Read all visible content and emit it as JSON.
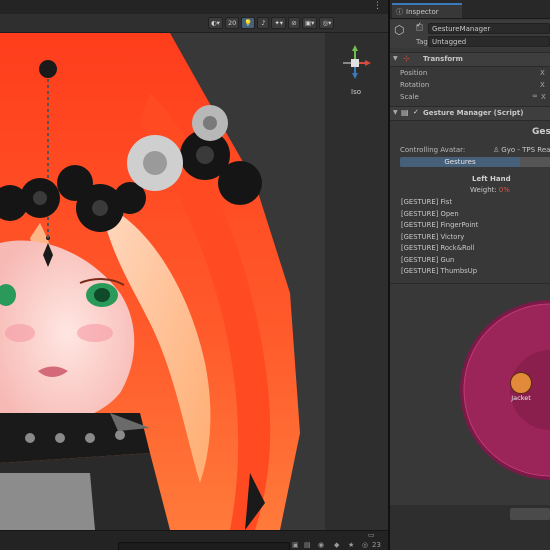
{
  "scene": {
    "toolbar": {
      "grid_size": "20",
      "iso_label": "Iso",
      "gizmo_count": "23"
    }
  },
  "inspector": {
    "tab_label": "Inspector",
    "object_name": "GestureManager",
    "tag_label": "Tag",
    "tag_value": "Untagged",
    "transform": {
      "title": "Transform",
      "position_label": "Position",
      "rotation_label": "Rotation",
      "scale_label": "Scale"
    },
    "component": {
      "title": "Gesture Manager (Script)",
      "header_text": "Gest",
      "controlling_avatar_label": "Controlling Avatar:",
      "controlling_avatar_value": "Gyo - TPS Read",
      "tab_active": "Gestures",
      "hand_title": "Left Hand",
      "weight_label": "Weight:",
      "weight_value": "0%",
      "gestures": [
        "[GESTURE] Fist",
        "[GESTURE] Open",
        "[GESTURE] FingerPoint",
        "[GESTURE] Victory",
        "[GESTURE] Rock&Roll",
        "[GESTURE] Gun",
        "[GESTURE] ThumbsUp"
      ],
      "radial_item_label": "Jacket"
    }
  },
  "colors": {
    "accent": "#3a79bb",
    "weight_value": "#e0534a",
    "radial_outer": "#8a1f52",
    "radial_inner": "#a8285f"
  }
}
